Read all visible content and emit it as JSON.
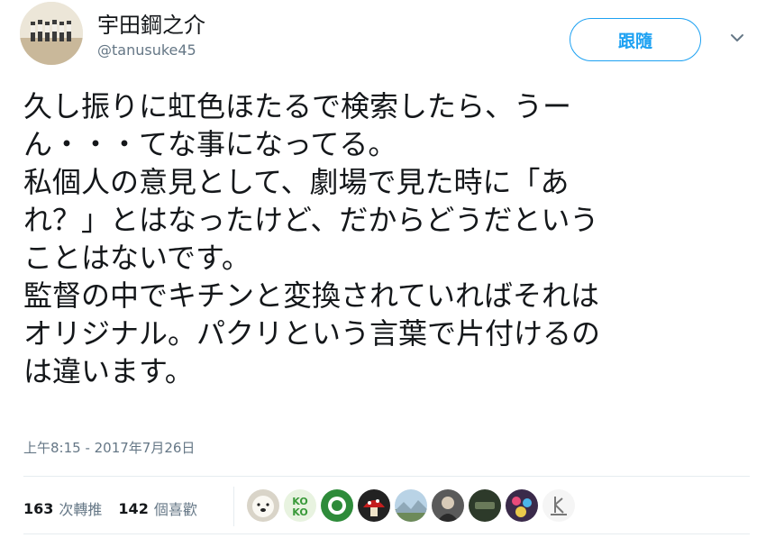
{
  "user": {
    "display_name": "宇田鋼之介",
    "handle": "@tanusuke45"
  },
  "follow_button": {
    "label": "跟隨"
  },
  "tweet": {
    "lines": [
      "久し振りに虹色ほたるで検索したら、うー",
      "ん・・・てな事になってる。",
      "私個人の意見として、劇場で見た時に「あ",
      "れ？」とはなったけど、だからどうだという",
      "ことはないです。",
      "監督の中でキチンと変換されていればそれは",
      "オリジナル。パクリという言葉で片付けるの",
      "は違います。"
    ],
    "timestamp": "上午8:15 - 2017年7月26日"
  },
  "stats": {
    "retweets": {
      "count": "163",
      "label": "次轉推"
    },
    "likes": {
      "count": "142",
      "label": "個喜歡"
    }
  },
  "likers": [
    {
      "icon": "avatar-polar-bear",
      "color": "#d9d4c8"
    },
    {
      "icon": "avatar-kokomo-text",
      "color": "#e8f3e0"
    },
    {
      "icon": "avatar-green-ring",
      "color": "#2e8b3a"
    },
    {
      "icon": "avatar-red-mushroom",
      "color": "#b51a1a"
    },
    {
      "icon": "avatar-landscape",
      "color": "#8fa8b8"
    },
    {
      "icon": "avatar-portrait",
      "color": "#5a5a5a"
    },
    {
      "icon": "avatar-dark-badge",
      "color": "#2d3a2a"
    },
    {
      "icon": "avatar-colorful-art",
      "color": "#3a2a4a"
    },
    {
      "icon": "avatar-white-logo",
      "color": "#f5f5f5"
    }
  ],
  "colors": {
    "accent": "#1da1f2",
    "text": "#14171a",
    "secondary": "#657786",
    "divider": "#e6ecf0"
  }
}
